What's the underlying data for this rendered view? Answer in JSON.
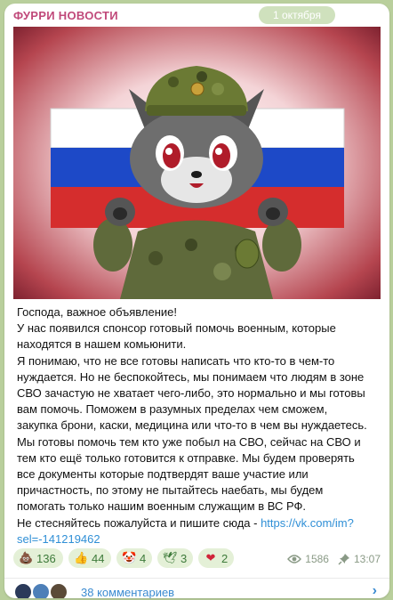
{
  "post": {
    "channel_name": "ФУРРИ НОВОСТИ",
    "date": "1 октября",
    "image_alt": "Фурри в военной форме на фоне российского флага",
    "text_lines": [
      "Господа, важное объявление!",
      "У нас появился спонсор готовый помочь военным, которые",
      "находятся в нашем комьюнити.",
      "Я понимаю, что не все готовы написать что кто-то в чем-то",
      "нуждается. Но не беспокойтесь, мы понимаем что людям в зоне",
      "СВО зачастую не хватает чего-либо, это нормально и мы готовы",
      "вам помочь. Поможем в разумных пределах чем сможем,",
      "закупка брони, каски, медицина или что-то в чем вы нуждаетесь.",
      "Мы готовы помочь тем кто уже побыл на СВО, сейчас на СВО и",
      "тем кто ещё только готовится к отправке. Мы будем проверять",
      "все документы которые подтвердят ваше участие или",
      "причастность, по этому не пытайтесь наебать, мы будем",
      "помогать только нашим военным служащим в ВС РФ."
    ],
    "cta_text": "Не стесняйтесь пожалуйста и пишите сюда - ",
    "link_part1": "https://vk.com/im?",
    "link_part2": "sel=-141219462"
  },
  "reactions": [
    {
      "emoji": "💩",
      "icon": "poop-icon",
      "count": "136"
    },
    {
      "emoji": "👍",
      "icon": "thumbs-up-icon",
      "count": "44"
    },
    {
      "emoji": "🤡",
      "icon": "clown-icon",
      "count": "4"
    },
    {
      "emoji": "🕊",
      "icon": "dove-icon",
      "count": "3"
    },
    {
      "emoji": "❤",
      "icon": "heart-icon",
      "count": "2"
    }
  ],
  "meta": {
    "views": "1586",
    "time": "13:07"
  },
  "comments": {
    "label": "38 комментариев"
  },
  "colors": {
    "channel": "#c0497a",
    "link": "#2f8fd6",
    "reaction_bg": "#e4f0d7",
    "chat_bg": "#b9cf9c"
  }
}
